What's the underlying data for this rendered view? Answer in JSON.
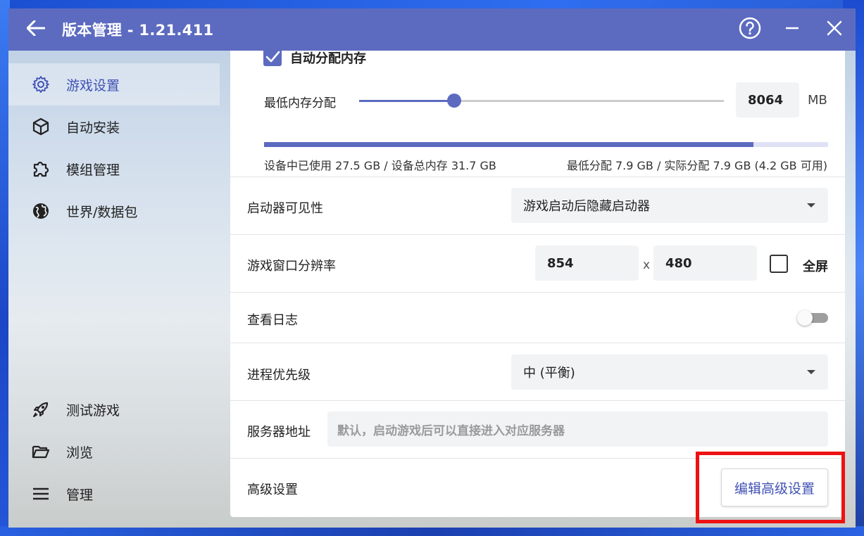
{
  "window": {
    "title": "版本管理 - 1.21.411"
  },
  "sidebar": {
    "items": [
      {
        "label": "游戏设置",
        "icon": "gear-icon",
        "active": true
      },
      {
        "label": "自动安装",
        "icon": "cube-icon",
        "active": false
      },
      {
        "label": "模组管理",
        "icon": "puzzle-icon",
        "active": false
      },
      {
        "label": "世界/数据包",
        "icon": "globe-icon",
        "active": false
      }
    ],
    "bottom_items": [
      {
        "label": "测试游戏",
        "icon": "rocket-icon"
      },
      {
        "label": "浏览",
        "icon": "folder-open-icon"
      },
      {
        "label": "管理",
        "icon": "menu-icon"
      }
    ]
  },
  "memory": {
    "auto_allocate_label": "自动分配内存",
    "auto_allocate_checked": true,
    "min_label": "最低内存分配",
    "min_value": "8064",
    "unit": "MB",
    "slider_fraction": 0.26,
    "usage_fraction": 0.868,
    "device_usage_text": "设备中已使用 27.5 GB / 设备总内存 31.7 GB",
    "allocation_text": "最低分配 7.9 GB / 实际分配 7.9 GB (4.2 GB 可用)"
  },
  "launcher_visibility": {
    "label": "启动器可见性",
    "selected": "游戏启动后隐藏启动器"
  },
  "resolution": {
    "label": "游戏窗口分辨率",
    "width": "854",
    "separator": "x",
    "height": "480",
    "fullscreen_label": "全屏",
    "fullscreen_checked": false
  },
  "log": {
    "label": "查看日志",
    "enabled": false
  },
  "priority": {
    "label": "进程优先级",
    "selected": "中 (平衡)"
  },
  "server": {
    "label": "服务器地址",
    "placeholder": "默认，启动游戏后可以直接进入对应服务器"
  },
  "advanced": {
    "label": "高级设置",
    "button_label": "编辑高级设置"
  },
  "colors": {
    "accent": "#5c6bc0",
    "highlight": "#ee1111"
  }
}
